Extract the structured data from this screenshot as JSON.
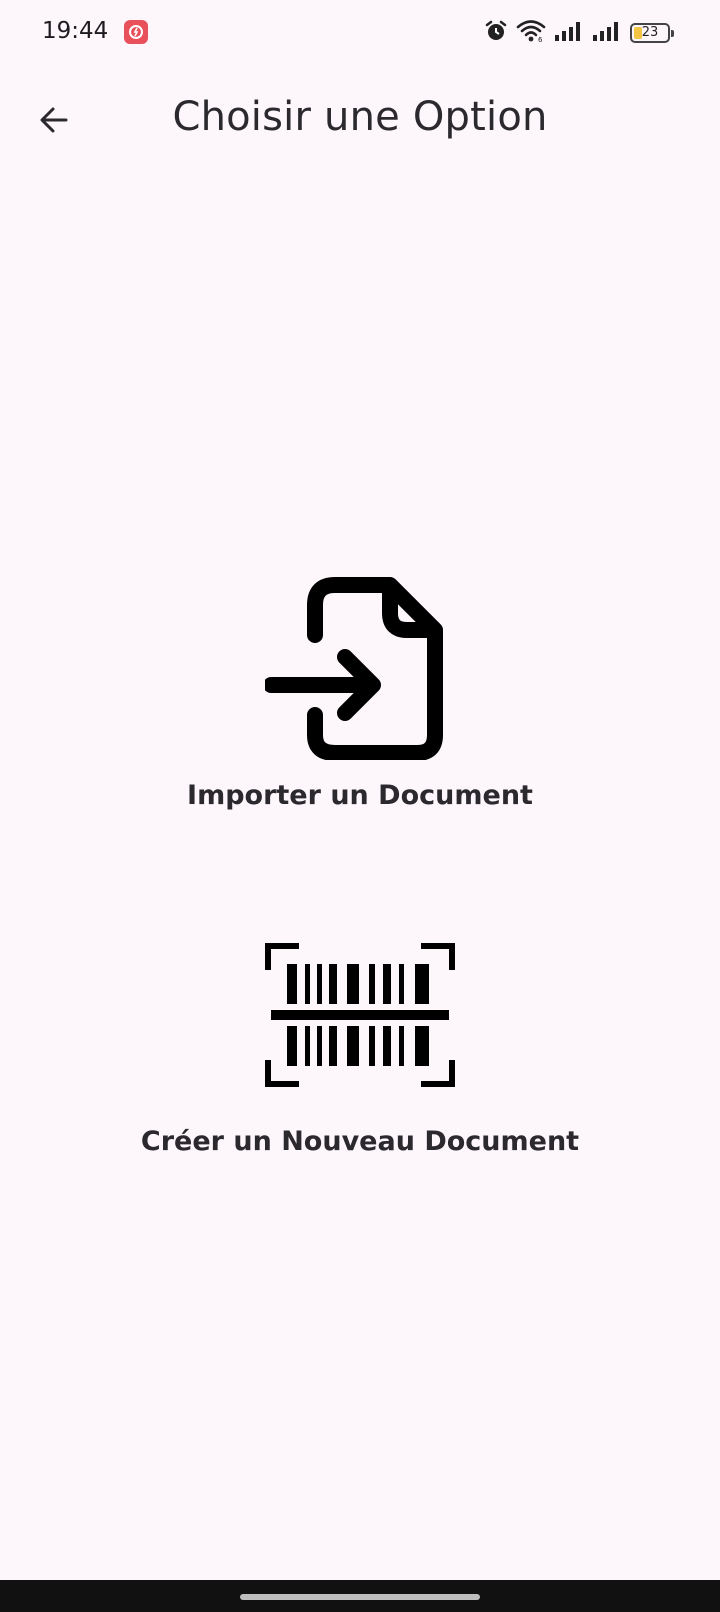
{
  "status_bar": {
    "time": "19:44",
    "notification_icon": "app-notification-icon",
    "alarm_icon": "alarm-icon",
    "wifi_icon": "wifi-icon",
    "signal_icons": [
      "signal-icon",
      "signal-icon"
    ],
    "battery_level": "23",
    "battery_color": "#F4C542"
  },
  "app_bar": {
    "back_icon": "arrow-left-icon",
    "title": "Choisir une Option"
  },
  "options": [
    {
      "icon": "file-import-icon",
      "label": "Importer un Document"
    },
    {
      "icon": "barcode-scan-icon",
      "label": "Créer un Nouveau Document"
    }
  ],
  "theme": {
    "background": "#FDF7FB",
    "icon_color": "#000000"
  }
}
